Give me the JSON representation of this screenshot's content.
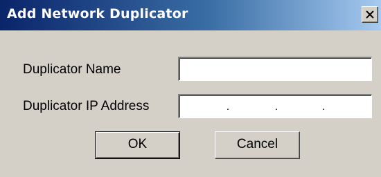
{
  "window": {
    "title": "Add Network Duplicator"
  },
  "form": {
    "name_label": "Duplicator Name",
    "name_value": "",
    "ip_label": "Duplicator IP Address",
    "ip_octets": [
      "",
      "",
      "",
      ""
    ],
    "ip_separator": "."
  },
  "buttons": {
    "ok_label": "OK",
    "cancel_label": "Cancel"
  },
  "icons": {
    "close": "close-icon"
  },
  "colors": {
    "titlebar_start": "#0a246a",
    "titlebar_end": "#a6caf0",
    "dialog_background": "#d4d0c8"
  }
}
